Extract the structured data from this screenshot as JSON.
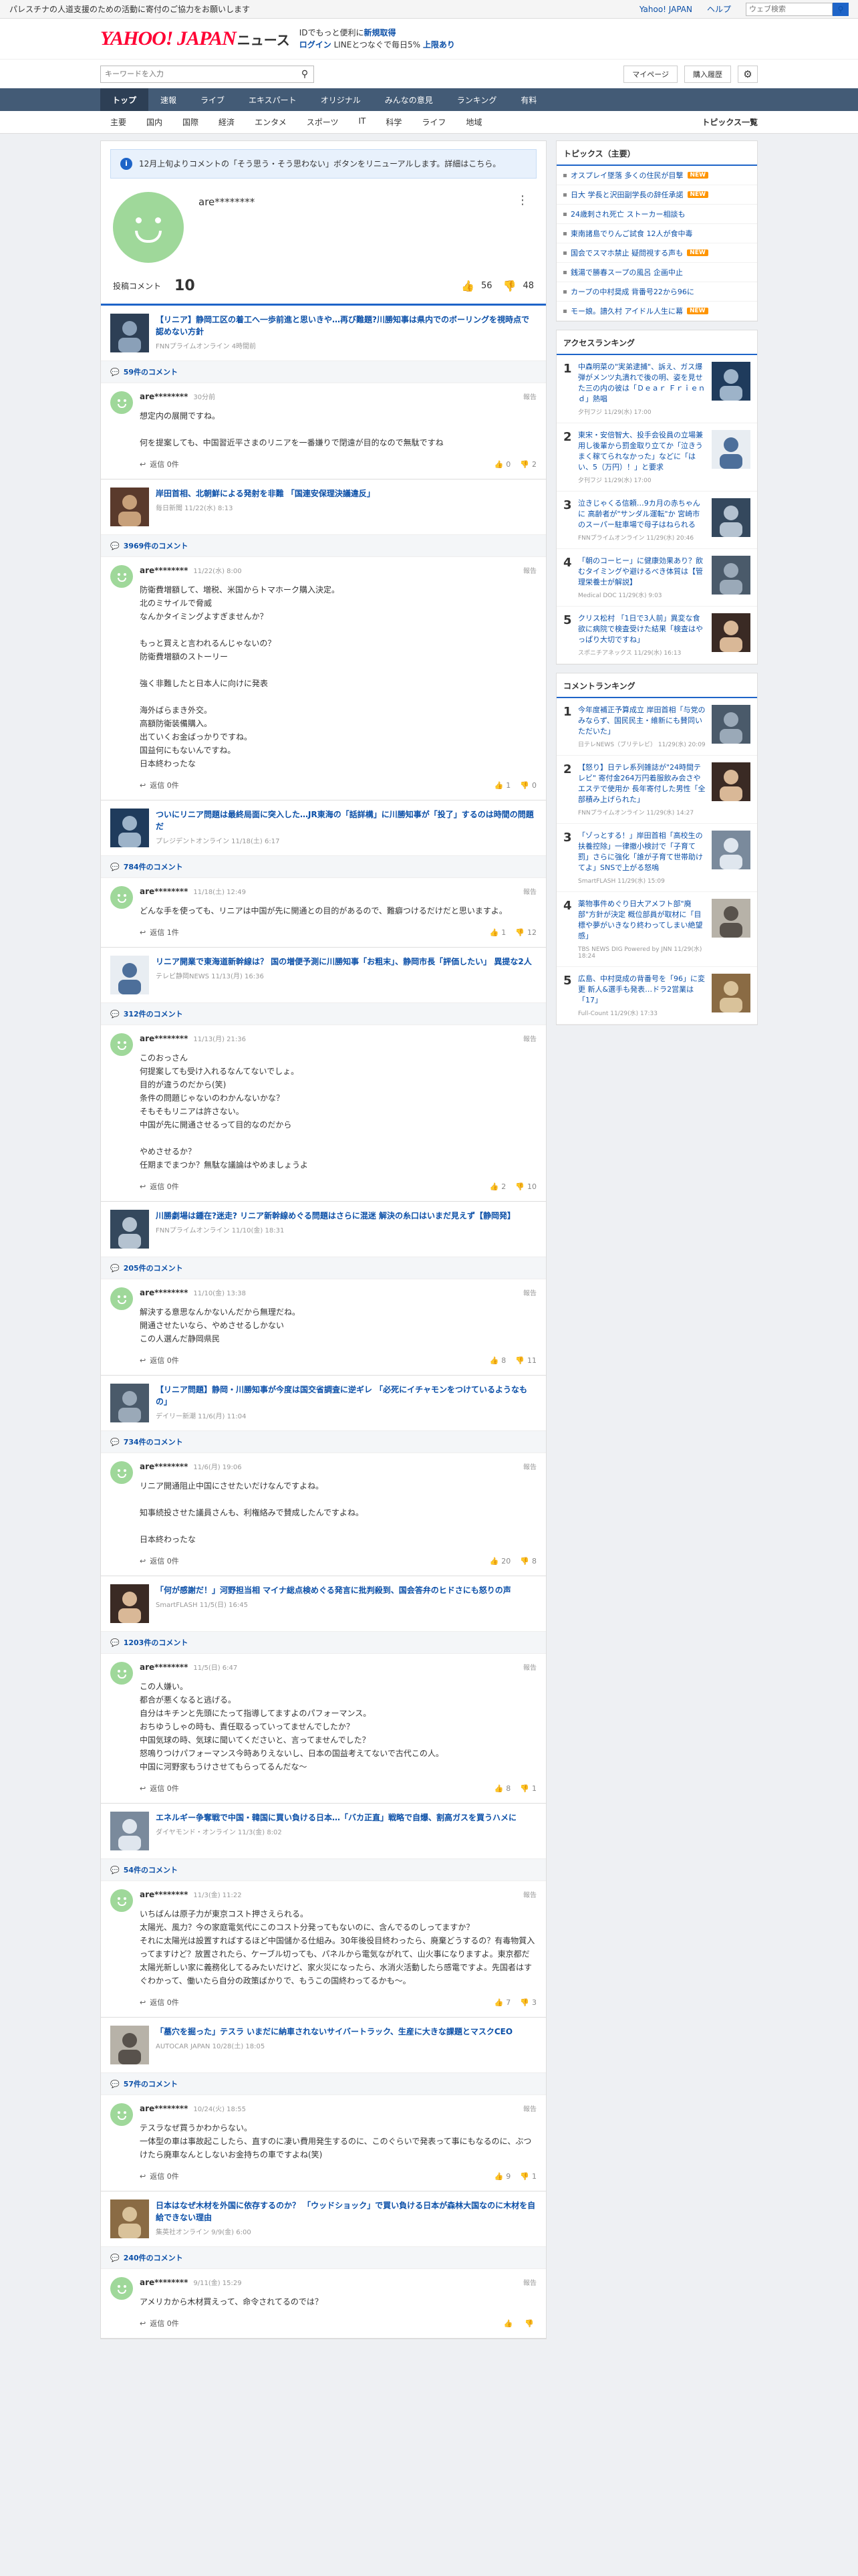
{
  "topbar": {
    "message": "パレスチナの人道支援のための活動に寄付のご協力をお願いします",
    "links": [
      "Yahoo! JAPAN",
      "ヘルプ"
    ],
    "search_placeholder": "ウェブ検索"
  },
  "masthead": {
    "logo": "YAHOO! JAPAN",
    "section": "ニュース",
    "promo_line1": "IDでもっと便利に",
    "promo_link1": "新規取得",
    "promo_line2_link": "ログイン",
    "promo_line2": "LINEとつなぐで毎日5%",
    "promo_link2": "上限あり"
  },
  "search": {
    "placeholder": "キーワードを入力",
    "mypage": "マイページ",
    "history": "購入履歴"
  },
  "gnav": [
    "トップ",
    "速報",
    "ライブ",
    "エキスパート",
    "オリジナル",
    "みんなの意見",
    "ランキング",
    "有料"
  ],
  "snav": {
    "items": [
      "主要",
      "国内",
      "国際",
      "経済",
      "エンタメ",
      "スポーツ",
      "IT",
      "科学",
      "ライフ",
      "地域"
    ],
    "all": "トピックス一覧"
  },
  "notice": "12月上旬よりコメントの「そう思う・そう思わない」ボタンをリニューアルします。詳細はこちら。",
  "profile": {
    "name": "are********",
    "posts_label": "投稿コメント",
    "posts": "10",
    "agree": "56",
    "disagree": "48"
  },
  "articles": [
    {
      "title": "【リニア】静岡工区の着工へ一歩前進と思いきや…再び難題?川勝知事は県内でのボーリングを視時点で認めない方針",
      "source": "FNNプライムオンライン 4時間前",
      "count": "59件のコメント",
      "user": "are********",
      "date": "30分前",
      "text": "想定内の展開ですね。\n\n何を提案しても、中国習近平さまのリニアを一番嫌りで閉遠が目的なので無駄ですね",
      "reply": "返信 0件",
      "agree": "0",
      "disagree": "2"
    },
    {
      "title": "岸田首相、北朝鮮による発射を非難 「国連安保理決議違反」",
      "source": "毎日新聞 11/22(水) 8:13",
      "count": "3969件のコメント",
      "user": "are********",
      "date": "11/22(水) 8:00",
      "text": "防衛費増額して、増税、米国からトマホーク購入決定。\n北のミサイルで脅威\nなんかタイミングよすぎませんか？\n\nもっと買えと言われるんじゃないの？\n防衛費増額のストーリー\n\n強く非難したと日本人に向けに発表\n\n海外ばらまき外交。\n高額防衛装備購入。\n出ていくお金ばっかりですね。\n国益何にもないんですね。\n日本終わったな",
      "reply": "返信 0件",
      "agree": "1",
      "disagree": "0"
    },
    {
      "title": "ついにリニア問題は最終局面に突入した…JR東海の「話詳構」に川勝知事が「投了」するのは時間の問題だ",
      "source": "プレジデントオンライン 11/18(土) 6:17",
      "count": "784件のコメント",
      "user": "are********",
      "date": "11/18(土) 12:49",
      "text": "どんな手を使っても、リニアは中国が先に開通との目的があるので、難癖つけるだけだと思いますよ。",
      "reply": "返信 1件",
      "agree": "1",
      "disagree": "12"
    },
    {
      "title": "リニア開業で東海道新幹線は？ 国の増便予測に川勝知事「お粗末」、静岡市長「評価したい」 異提な2人",
      "source": "テレビ静岡NEWS 11/13(月) 16:36",
      "count": "312件のコメント",
      "user": "are********",
      "date": "11/13(月) 21:36",
      "text": "このおっさん\n何提案しても受け入れるなんてないでしょ。\n目的が違うのだから(笑)\n条件の問題じゃないのわかんないかな？\nそもそもリニアは許さない。\n中国が先に開通させるって目的なのだから\n\nやめさせるか？\n任期までまつか？無駄な議論はやめましょうよ",
      "reply": "返信 0件",
      "agree": "2",
      "disagree": "10"
    },
    {
      "title": "川勝劇場は鍾在?迷走? リニア新幹線めぐる問題はさらに混迷 解決の糸口はいまだ見えず【静岡発】",
      "source": "FNNプライムオンライン 11/10(金) 18:31",
      "count": "205件のコメント",
      "user": "are********",
      "date": "11/10(金) 13:38",
      "text": "解決する意思なんかないんだから無理だね。\n開通させたいなら、やめさせるしかない\nこの人選んだ静岡県民",
      "reply": "返信 0件",
      "agree": "8",
      "disagree": "11"
    },
    {
      "title": "【リニア問題】静岡・川勝知事が今度は国交省調査に逆ギレ 「必死にイチャモンをつけているようなもの」",
      "source": "デイリー新潮 11/6(月) 11:04",
      "count": "734件のコメント",
      "user": "are********",
      "date": "11/6(月) 19:06",
      "text": "リニア開通阻止中国にさせたいだけなんですよね。\n\n知事続投させた議員さんも、利権絡みで賛成したんですよね。\n\n日本終わったな",
      "reply": "返信 0件",
      "agree": "20",
      "disagree": "8"
    },
    {
      "title": "「何が感謝だ！」河野担当相 マイナ総点検めぐる発言に批判殺到、国会答弁のヒドさにも怒りの声",
      "source": "SmartFLASH 11/5(日) 16:45",
      "count": "1203件のコメント",
      "user": "are********",
      "date": "11/5(日) 6:47",
      "text": "この人嫌い。\n都合が悪くなると逃げる。\n自分はキチンと先頭にたって指導してますよのパフォーマンス。\nおちゆうしゃの時も、責任取るっていってませんでしたか？\n中国気球の時、気球に聞いてくださいと、言ってませんでした？\n怒鳴りつけパフォーマンス今時ありえないし、日本の国益考えてないで古代この人。\n中国に河野家もうけさせてもらってるんだな〜",
      "reply": "返信 0件",
      "agree": "8",
      "disagree": "1"
    },
    {
      "title": "エネルギー争奪戦で中国・韓国に買い負ける日本…「バカ正直」戦略で自爆、割高ガスを買うハメに",
      "source": "ダイヤモンド・オンライン 11/3(金) 8:02",
      "count": "54件のコメント",
      "user": "are********",
      "date": "11/3(金) 11:22",
      "text": "いちばんは原子力が東京コスト押さえられる。\n太陽光、風力？今の家庭電気代にこのコスト分発ってもないのに、含んでるのしってますか？\nそれに太陽光は設置すればするほど中国儲かる仕組み。30年後役目終わったら、廃棄どうするの？有毒物質入ってますけど？放置されたら、ケーブル切っても、パネルから電気ながれて、山火事になりますよ。東京都だ太陽光新しい家に義務化してるみたいだけど、家火災になったら、水消火活動したら感電ですよ。先国者はすぐわかって、働いたら自分の政策ばかりで、もうこの国終わってるかも〜。",
      "reply": "返信 0件",
      "agree": "7",
      "disagree": "3"
    },
    {
      "title": "「墓穴を掘った」テスラ いまだに納車されないサイバートラック、生産に大きな課題とマスクCEO",
      "source": "AUTOCAR JAPAN 10/28(土) 18:05",
      "count": "57件のコメント",
      "user": "are********",
      "date": "10/24(火) 18:55",
      "text": "テスラなぜ買うかわからない。\n一体型の車は事故起こしたら、直すのに凄い費用発生するのに、このぐらいで発表って事にもなるのに、ぶつけたら廃車なんとしないお金持ちの車ですよね(笑)",
      "reply": "返信 0件",
      "agree": "9",
      "disagree": "1"
    },
    {
      "title": "日本はなぜ木材を外国に依存するのか？ 「ウッドショック」で買い負ける日本が森林大国なのに木材を自給できない理由",
      "source": "集英社オンライン 9/9(金) 6:00",
      "count": "240件のコメント",
      "user": "are********",
      "date": "9/11(金) 15:29",
      "text": "アメリカから木材買えって、命令されてるのでは？",
      "reply": "返信 0件",
      "agree": "",
      "disagree": ""
    }
  ],
  "topics": {
    "heading": "トピックス（主要）",
    "items": [
      {
        "text": "オスプレイ墜落 多くの住民が目撃",
        "new": "NEW"
      },
      {
        "text": "日大 学長と沢田副学長の辞任承諾",
        "new": "NEW"
      },
      {
        "text": "24歳刺され死亡 ストーカー相談も",
        "new": ""
      },
      {
        "text": "東南諸島でりんご試食 12人が食中毒",
        "new": ""
      },
      {
        "text": "国会でスマホ禁止 疑問視する声も",
        "new": "NEW"
      },
      {
        "text": "銭湯で勝春スープの風呂 企画中止",
        "new": ""
      },
      {
        "text": "カープの中村奨成 背番号22から96に",
        "new": ""
      },
      {
        "text": "モー娘。譜久村 アイドル人生に幕",
        "new": "NEW"
      }
    ]
  },
  "access": {
    "heading": "アクセスランキング",
    "items": [
      {
        "n": "1",
        "title": "中森明菜の\"実弟逮捕\"、訴え、ガス爆弾がメンツ丸潰れで後の明、姿を見せた三の内の彼は「Ｄｅａｒ Ｆｒｉｅｎｄ」熱唱",
        "source": "夕刊フジ 11/29(水) 17:00"
      },
      {
        "n": "2",
        "title": "東宋・安倍智大、投手会役員の立場兼用し後輩から罰金取り立てか「泣きうまく稼てられなかった」などに「はい、5（万円）！」と要求",
        "source": "夕刊フジ 11/29(水) 17:00"
      },
      {
        "n": "3",
        "title": "泣きじゃくる信頼…9カ月の赤ちゃんに 高齢者が\"サンダル運転\"か 宮崎市のスーパー駐車場で母子はねられる",
        "source": "FNNプライムオンライン 11/29(水) 20:46"
      },
      {
        "n": "4",
        "title": "「朝のコーヒー」に健康効果あり？飲むタイミングや避けるべき体質は【管理栄養士が解説】",
        "source": "Medical DOC 11/29(水) 9:03"
      },
      {
        "n": "5",
        "title": "クリス松村 「1日で3人前」異変な食欲に病院で検査受けた結果「検査はやっぱり大切ですね」",
        "source": "スポニチアネックス 11/29(水) 16:13"
      }
    ]
  },
  "commentrank": {
    "heading": "コメントランキング",
    "items": [
      {
        "n": "1",
        "title": "今年度補正予算成立 岸田首相「与党のみならず、国民民主・維新にも賛同いただいた」",
        "source": "日テレNEWS（ブリテレビ） 11/29(水) 20:09"
      },
      {
        "n": "2",
        "title": "【怒り】日テレ系列雑誌が\"24時間テレビ\" 寄付金264万円着服飲み会さやエステで使用か 長年寄付した男性「全部積み上げられた」",
        "source": "FNNプライムオンライン 11/29(水) 14:27"
      },
      {
        "n": "3",
        "title": "「ゾっとする！」岸田首相「高校生の扶養控除」一律撤小検討で「子育て罰」さらに強化「誰が子育て世帯助けてよ」SNSで上がる怒嗚",
        "source": "SmartFLASH 11/29(水) 15:09"
      },
      {
        "n": "4",
        "title": "薬物事件めぐり日大アメフト部\"廃部\"方針が決定 概位部員が取材に「目標や夢がいきなり終わってしまい絶望感」",
        "source": "TBS NEWS DIG Powered by JNN 11/29(水) 18:24"
      },
      {
        "n": "5",
        "title": "広島、中村奨成の背番号を「96」に変更 新人&選手も発表…ドラ2営業は「17」",
        "source": "Full-Count 11/29(水) 17:33"
      }
    ]
  },
  "colors": {
    "accent": "#1e64c8",
    "nav": "#435b76",
    "avatar": "#9fd89a",
    "link": "#0c50a8",
    "new": "#ff9500"
  }
}
